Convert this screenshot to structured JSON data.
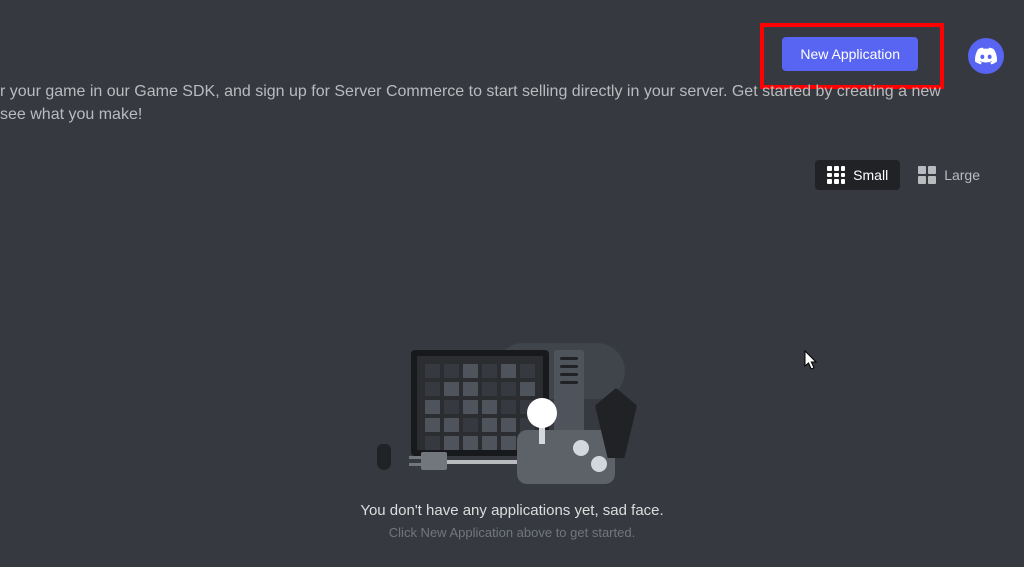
{
  "header": {
    "new_application_label": "New Application"
  },
  "intro": {
    "line1": "r your game in our Game SDK, and sign up for Server Commerce to start selling directly in your server. Get started by creating a new",
    "line2": "see what you make!"
  },
  "view_toggle": {
    "small_label": "Small",
    "large_label": "Large",
    "active": "small"
  },
  "empty_state": {
    "primary": "You don't have any applications yet, sad face.",
    "secondary": "Click New Application above to get started."
  },
  "highlight": {
    "target": "new-application-button",
    "redbox": true
  }
}
